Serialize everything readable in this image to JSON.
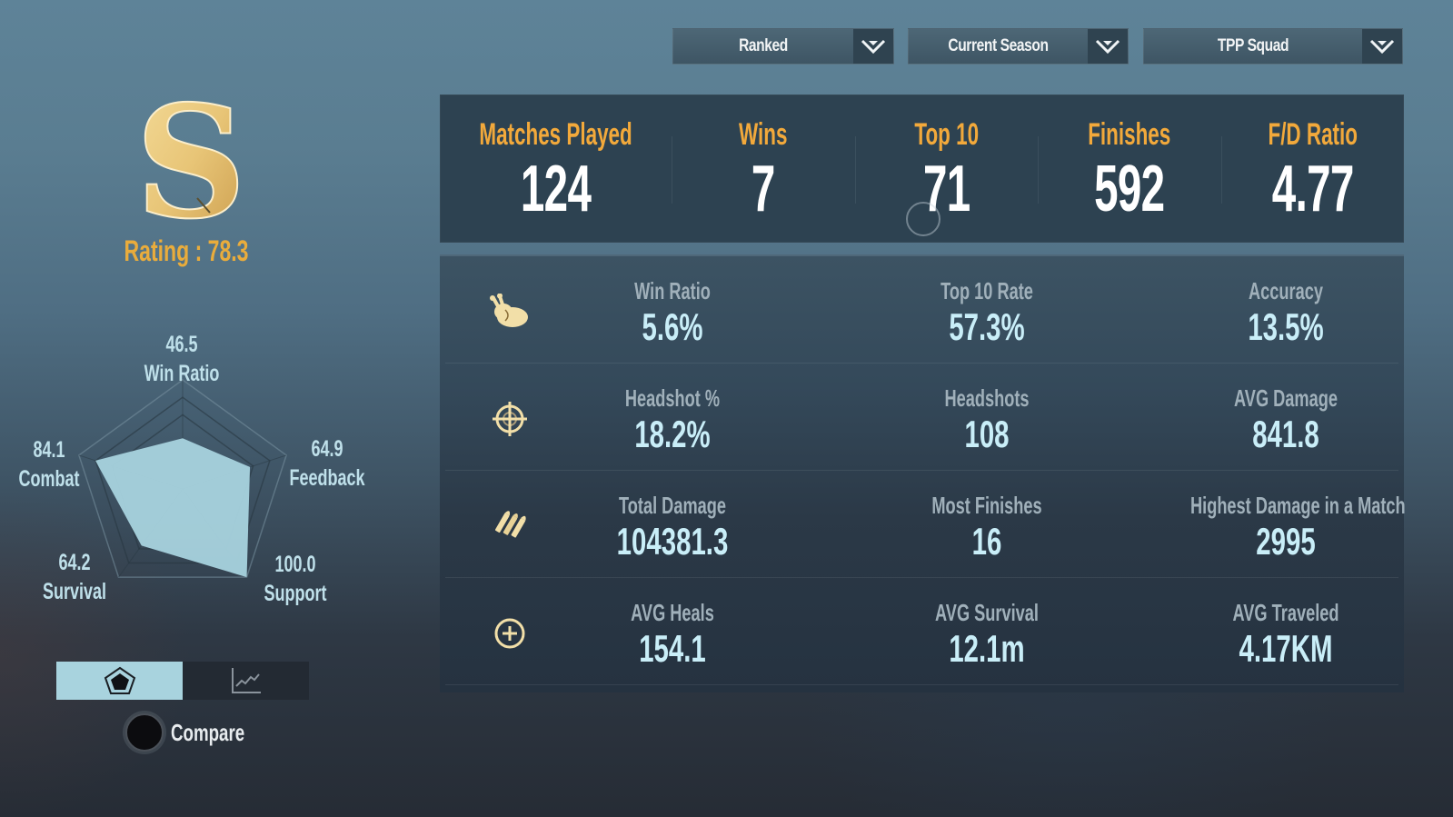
{
  "filters": {
    "mode": "Ranked",
    "season": "Current Season",
    "squad": "TPP Squad"
  },
  "profile": {
    "tier_letter": "S",
    "tier_color": "#e9c77a",
    "rating_text": "Rating : 78.3",
    "rating_color": "#e9ac3c"
  },
  "radar": {
    "fill_color": "#a8d3de",
    "axes": [
      {
        "name": "Win Ratio",
        "value": 46.5,
        "display": "46.5"
      },
      {
        "name": "Feedback",
        "value": 64.9,
        "display": "64.9"
      },
      {
        "name": "Support",
        "value": 100.0,
        "display": "100.0"
      },
      {
        "name": "Survival",
        "value": 64.2,
        "display": "64.2"
      },
      {
        "name": "Combat",
        "value": 84.1,
        "display": "84.1"
      }
    ],
    "max": 100
  },
  "view_toggle": {
    "selected": "radar",
    "options": [
      "radar-chart-icon",
      "line-chart-icon"
    ]
  },
  "compare": {
    "label": "Compare",
    "enabled": false
  },
  "summary": [
    {
      "label": "Matches Played",
      "value": "124"
    },
    {
      "label": "Wins",
      "value": "7"
    },
    {
      "label": "Top 10",
      "value": "71"
    },
    {
      "label": "Finishes",
      "value": "592"
    },
    {
      "label": "F/D Ratio",
      "value": "4.77"
    }
  ],
  "details": [
    {
      "icon": "chicken-icon",
      "stats": [
        {
          "label": "Win Ratio",
          "value": "5.6%"
        },
        {
          "label": "Top 10 Rate",
          "value": "57.3%"
        },
        {
          "label": "Accuracy",
          "value": "13.5%"
        }
      ]
    },
    {
      "icon": "crosshair-icon",
      "stats": [
        {
          "label": "Headshot %",
          "value": "18.2%"
        },
        {
          "label": "Headshots",
          "value": "108"
        },
        {
          "label": "AVG Damage",
          "value": "841.8"
        }
      ]
    },
    {
      "icon": "bullets-icon",
      "stats": [
        {
          "label": "Total Damage",
          "value": "104381.3"
        },
        {
          "label": "Most Finishes",
          "value": "16"
        },
        {
          "label": "Highest Damage in a Match",
          "value": "2995"
        }
      ]
    },
    {
      "icon": "heal-plus-icon",
      "stats": [
        {
          "label": "AVG Heals",
          "value": "154.1"
        },
        {
          "label": "AVG Survival",
          "value": "12.1m"
        },
        {
          "label": "AVG Traveled",
          "value": "4.17KM"
        }
      ]
    }
  ],
  "colors": {
    "accent_orange": "#f2a93b",
    "value_cyan": "#c9eef8",
    "label_gray": "#a0b0ba",
    "icon_cream": "#f2dfa8"
  }
}
